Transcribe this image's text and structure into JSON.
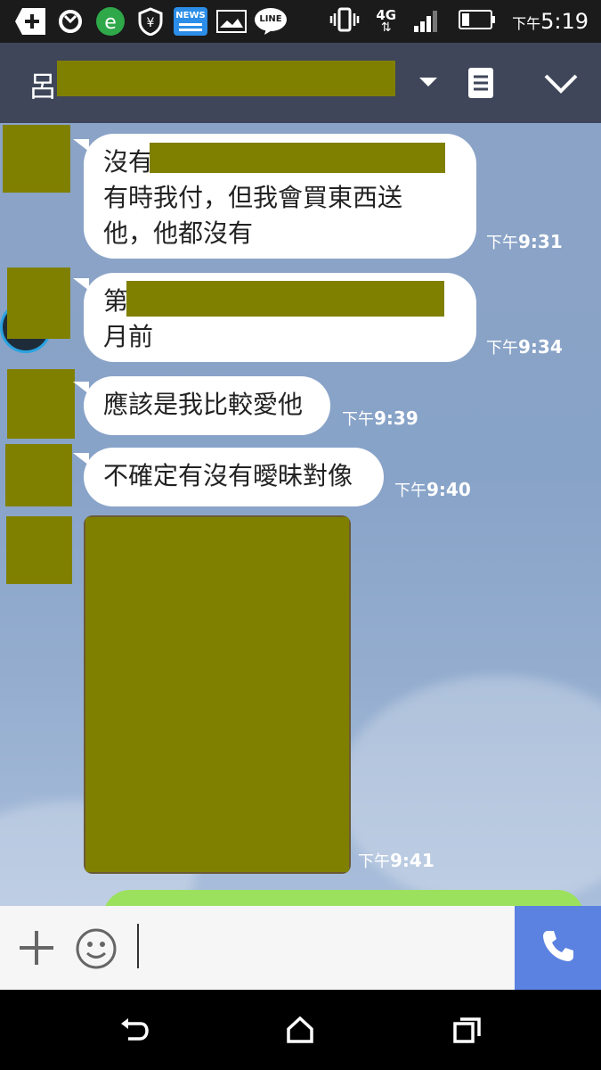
{
  "status_bar": {
    "news_label": "NEWS",
    "line_label": "LINE",
    "network": "4G",
    "time_prefix": "下午",
    "time": "5:19"
  },
  "header": {
    "contact_name_visible": "呂"
  },
  "messages": [
    {
      "lines": [
        "沒有",
        "有時我付，但我會買東西送",
        "他，他都沒有"
      ],
      "time_prefix": "下午",
      "time": "9:31"
    },
    {
      "lines": [
        "第",
        "月前"
      ],
      "time_prefix": "下午",
      "time": "9:34"
    },
    {
      "lines": [
        "應該是我比較愛他"
      ],
      "time_prefix": "下午",
      "time": "9:39"
    },
    {
      "lines": [
        "不確定有沒有曖昧對像"
      ],
      "time_prefix": "下午",
      "time": "9:40"
    },
    {
      "type": "image",
      "time_prefix": "下午",
      "time": "9:41"
    }
  ],
  "colors": {
    "header_bg": "#3f4659",
    "redaction": "#808000",
    "outgoing_bubble": "#9be15e",
    "call_button": "#5b82e0"
  }
}
